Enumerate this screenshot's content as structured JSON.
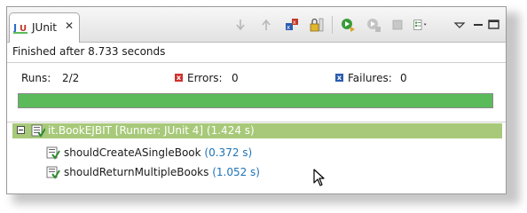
{
  "tab": {
    "label": "JUnit",
    "icon": "junit-icon",
    "close_icon": "close-icon"
  },
  "toolbar": {
    "icons": [
      "next-failure-icon",
      "previous-failure-icon",
      "show-failures-only-icon",
      "scroll-lock-icon",
      "rerun-test-icon",
      "rerun-failed-first-icon",
      "stop-icon",
      "test-run-history-icon",
      "view-menu-icon",
      "minimize-icon",
      "maximize-icon"
    ]
  },
  "status": {
    "finished": "Finished after 8.733 seconds"
  },
  "stats": {
    "runs_label": "Runs:",
    "runs_value": "2/2",
    "errors_label": "Errors:",
    "errors_value": "0",
    "failures_label": "Failures:",
    "failures_value": "0"
  },
  "progress": {
    "fraction": 1.0,
    "color": "#5bbb5b"
  },
  "tree": {
    "root": {
      "text": "it.BookEJBIT [Runner: JUnit 4] (1.424 s)",
      "highlight": "#a7c979"
    },
    "children": [
      {
        "name": "shouldCreateASingleBook",
        "time": "(0.372 s)"
      },
      {
        "name": "shouldReturnMultipleBooks",
        "time": "(1.052 s)"
      }
    ]
  }
}
